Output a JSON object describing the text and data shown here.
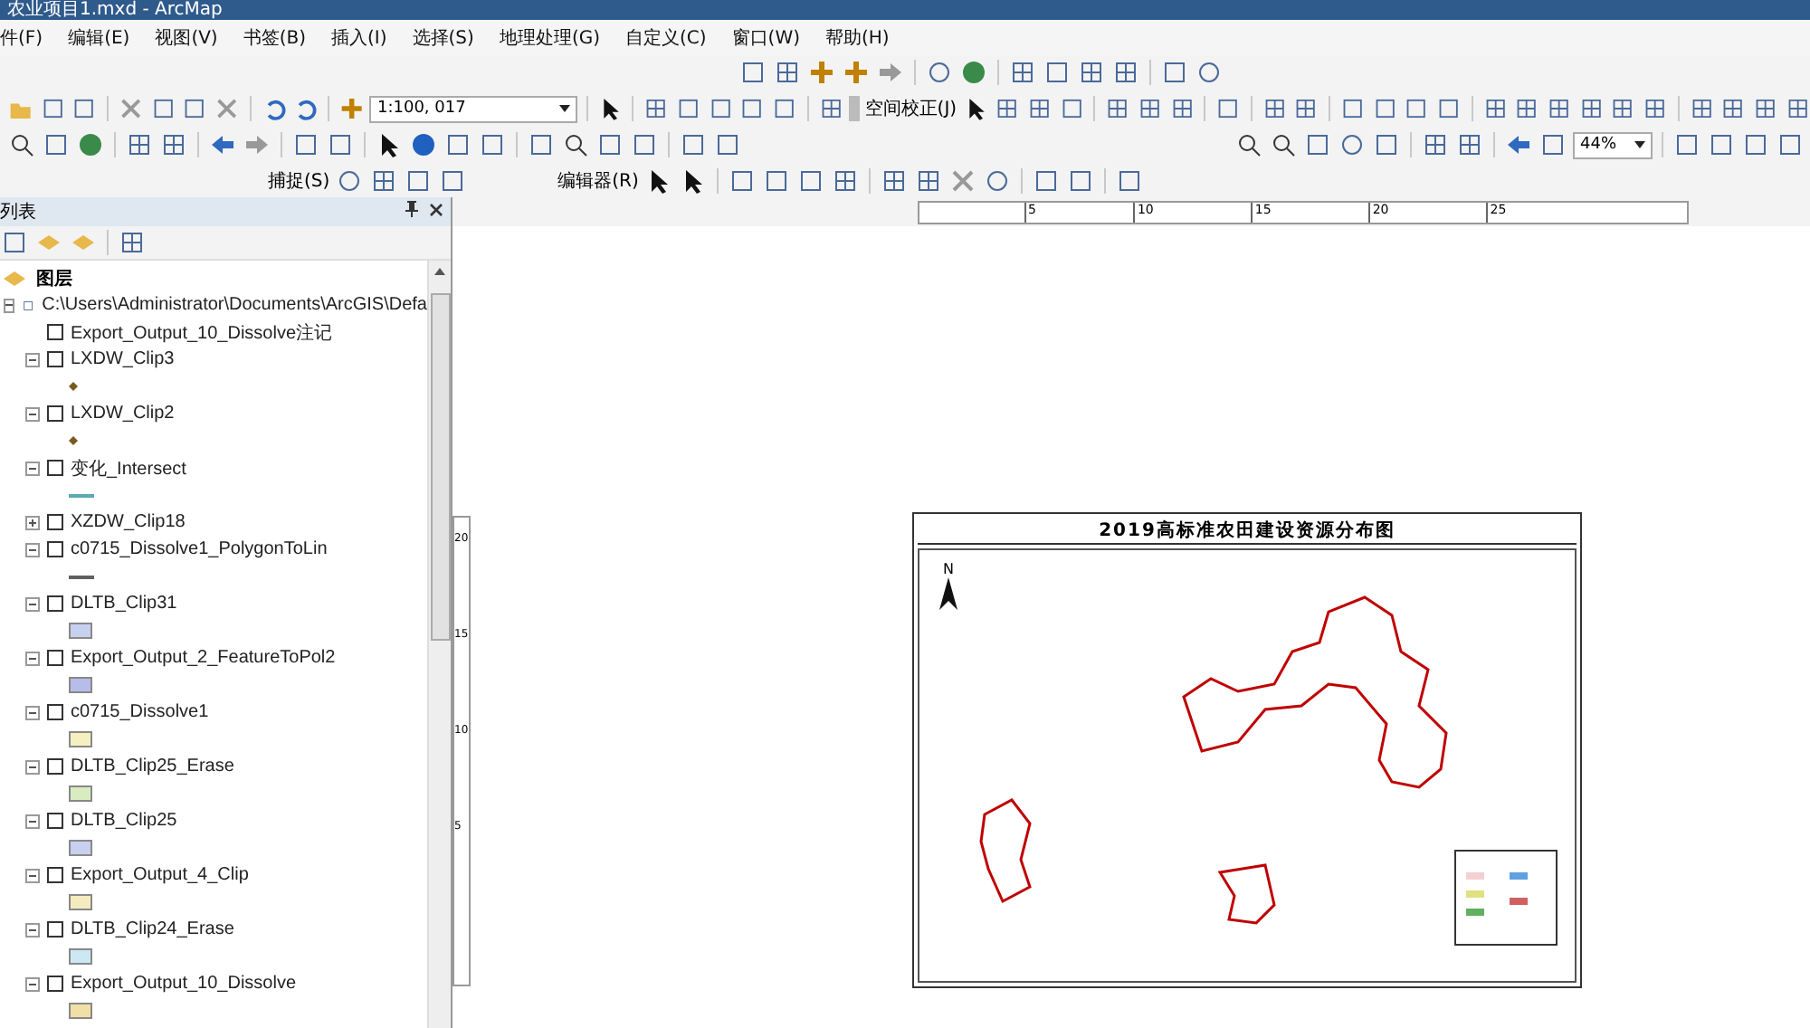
{
  "window": {
    "title": "农业项目1.mxd - ArcMap"
  },
  "menu": [
    "件(F)",
    "编辑(E)",
    "视图(V)",
    "书签(B)",
    "插入(I)",
    "选择(S)",
    "地理处理(G)",
    "自定义(C)",
    "窗口(W)",
    "帮助(H)"
  ],
  "toolbars": {
    "scale": "1:100, 017",
    "spatial_adjustment": "空间校正(J)",
    "snapping": "捕捉(S)",
    "editor": "编辑器(R)",
    "zoom": "44%"
  },
  "toc": {
    "title": "列表",
    "root": "图层",
    "source": "C:\\Users\\Administrator\\Documents\\ArcGIS\\Defa",
    "layers": [
      {
        "name": "Export_Output_10_Dissolve注记",
        "checked": false
      },
      {
        "name": "LXDW_Clip3",
        "checked": false,
        "expanded": true,
        "symbol": {
          "kind": "point",
          "color": "#7a5a20"
        }
      },
      {
        "name": "LXDW_Clip2",
        "checked": false,
        "expanded": true,
        "symbol": {
          "kind": "point",
          "color": "#7a5a20"
        }
      },
      {
        "name": "变化_Intersect",
        "checked": false,
        "expanded": true,
        "symbol": {
          "kind": "line",
          "color": "#5aaab0"
        }
      },
      {
        "name": "XZDW_Clip18",
        "checked": false,
        "expanded": false
      },
      {
        "name": "c0715_Dissolve1_PolygonToLin",
        "checked": false,
        "expanded": true,
        "symbol": {
          "kind": "line",
          "color": "#606060"
        }
      },
      {
        "name": "DLTB_Clip31",
        "checked": false,
        "expanded": true,
        "symbol": {
          "kind": "fill",
          "color": "#c8d0f0"
        }
      },
      {
        "name": "Export_Output_2_FeatureToPol2",
        "checked": false,
        "expanded": true,
        "symbol": {
          "kind": "fill",
          "color": "#b8bce8"
        }
      },
      {
        "name": "c0715_Dissolve1",
        "checked": false,
        "expanded": true,
        "symbol": {
          "kind": "fill",
          "color": "#f4f0c0"
        }
      },
      {
        "name": "DLTB_Clip25_Erase",
        "checked": false,
        "expanded": true,
        "symbol": {
          "kind": "fill",
          "color": "#d8ecc0"
        }
      },
      {
        "name": "DLTB_Clip25",
        "checked": false,
        "expanded": true,
        "symbol": {
          "kind": "fill",
          "color": "#c8d0f0"
        }
      },
      {
        "name": "Export_Output_4_Clip",
        "checked": false,
        "expanded": true,
        "symbol": {
          "kind": "fill",
          "color": "#f4ecc0"
        }
      },
      {
        "name": "DLTB_Clip24_Erase",
        "checked": false,
        "expanded": true,
        "symbol": {
          "kind": "fill",
          "color": "#cce8f4"
        }
      },
      {
        "name": "Export_Output_10_Dissolve",
        "checked": false,
        "expanded": true,
        "symbol": {
          "kind": "fill",
          "color": "#f0e0a8"
        }
      }
    ]
  },
  "rulers": {
    "horizontal": [
      "5",
      "10",
      "15",
      "20",
      "25"
    ],
    "vertical": [
      "20",
      "15",
      "10",
      "5"
    ]
  },
  "map": {
    "title": "2019高标准农田建设资源分布图",
    "north": "N"
  }
}
